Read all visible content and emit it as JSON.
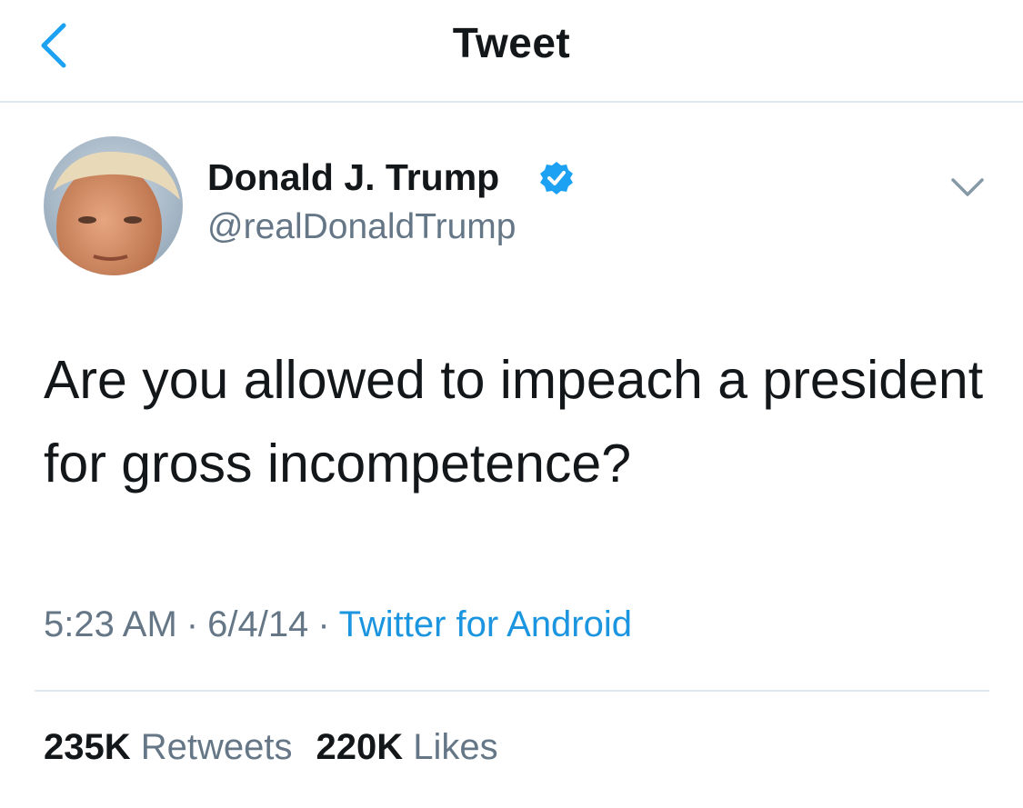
{
  "header": {
    "title": "Tweet",
    "back_icon": "chevron-left-icon",
    "accent_color": "#1da1f2"
  },
  "author": {
    "display_name": "Donald J. Trump",
    "handle": "@realDonaldTrump",
    "verified": true,
    "verified_icon": "verified-badge-icon",
    "avatar_icon": "profile-photo"
  },
  "tweet": {
    "text": "Are you allowed to impeach a president for gross incompetence?",
    "menu_icon": "chevron-down-icon"
  },
  "meta": {
    "time": "5:23 AM",
    "separator": "·",
    "date": "6/4/14",
    "source": "Twitter for Android",
    "source_color": "#1b95e0"
  },
  "stats": {
    "retweets_count": "235K",
    "retweets_label": "Retweets",
    "likes_count": "220K",
    "likes_label": "Likes"
  },
  "colors": {
    "text_primary": "#14171a",
    "text_secondary": "#657786",
    "divider": "#e1e8ed"
  }
}
